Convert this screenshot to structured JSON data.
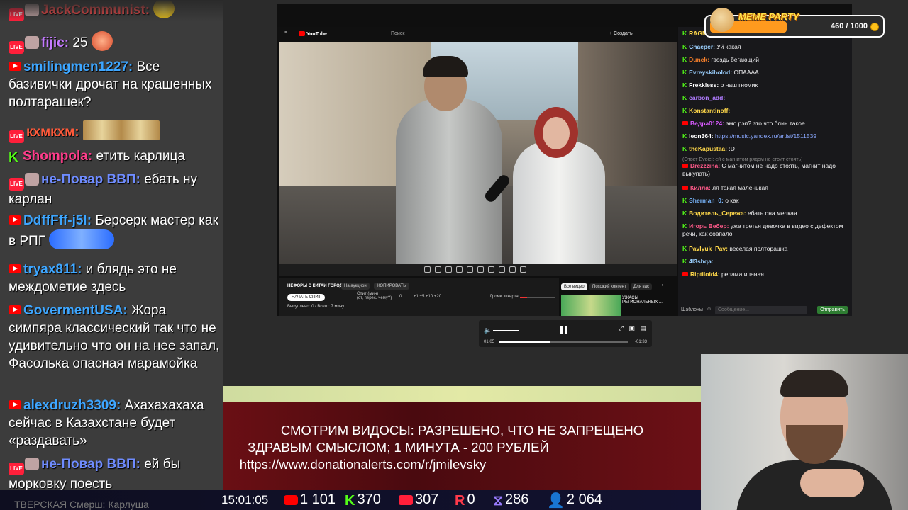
{
  "left_chat": [
    {
      "badge": "live",
      "nick": "JackCommunist:",
      "color": "#ff4a4a",
      "text": "",
      "top": 0
    },
    {
      "badge": "live",
      "nick": "fijic:",
      "color": "#c47aff",
      "text": "25"
    },
    {
      "badge": "yt",
      "nick": "smilingmen1227:",
      "color": "#3ea6ff",
      "text": "Все базивички дрочат на крашенных полтарашек?"
    },
    {
      "badge": "live",
      "nick": "кхмкхм:",
      "color": "#ff5a3a",
      "text": ""
    },
    {
      "badge": "kick",
      "nick": "Shompola:",
      "color": "#ff3d8b",
      "text": "етить карлица"
    },
    {
      "badge": "live",
      "nick": "не-Повар ВВП:",
      "color": "#6f8cff",
      "text": "ебать ну карлан"
    },
    {
      "badge": "yt",
      "nick": "DdffFff-j5l:",
      "color": "#3ea6ff",
      "text": "Берсерк мастер как в РПГ"
    },
    {
      "badge": "yt",
      "nick": "tryax811:",
      "color": "#3ea6ff",
      "text": "и блядь это не междометие здесь"
    },
    {
      "badge": "yt",
      "nick": "GovermentUSA:",
      "color": "#3ea6ff",
      "text": "Жора симпяра классический так что не удивительно что он на нее запал, Фасолька опасная марамойка"
    },
    {
      "badge": "yt",
      "nick": "alexdruzh3309:",
      "color": "#3ea6ff",
      "text": "Ахахахахаха сейчас в Казахстане будет «раздавать»"
    },
    {
      "badge": "live",
      "nick": "не-Повар ВВП:",
      "color": "#6f8cff",
      "text": "ей бы морковку поесть"
    }
  ],
  "browser": {
    "yt_logo": "YouTube",
    "search_placeholder": "Поиск",
    "create_label": "+ Создать",
    "donate_title": "НЕФОРЫ С КИТАЙ ГОРОДА",
    "auction_label": "На аукцион",
    "copy_label": "КОПИРОВАТЬ",
    "start_label": "НАЧАТЬ СПИТ",
    "spent_label": "Выкуплено: 0 / Всего: 7 минут",
    "spit_label": "Спит (мин)",
    "spit_sub": "(от, перес. чему?)",
    "spit_value": "0",
    "steps": "+1  +5  +10  +20",
    "volume_label": "Громк. шкерта",
    "reco_tabs": [
      "Все видео",
      "Похожий контент",
      "Для вас"
    ],
    "reco_title": "УЖАСЫ РЕГИОНАЛЬНЫХ ..."
  },
  "video_controls": {
    "current": "01:05",
    "remaining": "-01:33",
    "progress": 0.4
  },
  "right_chat": [
    {
      "src": "kick",
      "nick": "RAGNAROCK:",
      "color": "#ffd84a",
      "text": "ебать шкет"
    },
    {
      "src": "kick",
      "nick": "Chaeper:",
      "color": "#9bd0ff",
      "text": "Уй какая"
    },
    {
      "src": "kick",
      "nick": "Dunck:",
      "color": "#f27d2a",
      "text": "гвоздь бегающий"
    },
    {
      "src": "kick",
      "nick": "Evreyskiholod:",
      "color": "#9bd0ff",
      "text": "ОПАААА"
    },
    {
      "src": "kick",
      "nick": "Frekkless:",
      "color": "#ffffff",
      "text": "о наш гномик"
    },
    {
      "src": "kick",
      "nick": "carbon_add:",
      "color": "#b07cff",
      "text": ""
    },
    {
      "src": "kick",
      "nick": "Konstantinoff:",
      "color": "#ffd84a",
      "text": ""
    },
    {
      "src": "yt",
      "nick": "Ведра0124:",
      "color": "#d85aff",
      "text": "эмо рэп? это что блин такое"
    },
    {
      "src": "kick",
      "nick": "leon364:",
      "color": "#ffffff",
      "text": "",
      "link": "https://music.yandex.ru/artist/1511539"
    },
    {
      "src": "kick",
      "nick": "theKapustaa:",
      "color": "#ffd84a",
      "text": ":D"
    },
    {
      "src": "sub",
      "nick": "",
      "color": "#888",
      "text": "(Ответ Evoiel: ей с магнитом рядом не стоит стоять)"
    },
    {
      "src": "yt",
      "nick": "Drezzzina:",
      "color": "#ff5a8a",
      "text": "С магнитом не надо стоять, магнит надо выкупать)"
    },
    {
      "src": "yt",
      "nick": "Килла:",
      "color": "#ff5a8a",
      "text": "ля такая маленькая"
    },
    {
      "src": "kick",
      "nick": "Sherman_0:",
      "color": "#7ab8ff",
      "text": "о как"
    },
    {
      "src": "kick",
      "nick": "Водитель_Сережа:",
      "color": "#ffd84a",
      "text": "ебать она мелкая"
    },
    {
      "src": "kick",
      "nick": "Игорь Вебер:",
      "color": "#ff5a8a",
      "text": "уже третья девочка в видео с дефектом речи, как совпало"
    },
    {
      "src": "kick",
      "nick": "Pavlyuk_Pav:",
      "color": "#ffd84a",
      "text": "веселая полторашка"
    },
    {
      "src": "kick",
      "nick": "4l3shqa:",
      "color": "#9bd0ff",
      "text": ""
    },
    {
      "src": "yt",
      "nick": "Riptiloid4:",
      "color": "#ffd84a",
      "text": "релама ипаная"
    }
  ],
  "chat_input": {
    "templates": "Шаблоны",
    "placeholder": "Сообщение...",
    "send": "Отправить"
  },
  "meme_party": {
    "title": "MEME PARTY",
    "count": "460 / 1000",
    "progress": 0.46
  },
  "banner": {
    "line1": "СМОТРИМ ВИДОСЫ: РАЗРЕШЕНО, ЧТО НЕ ЗАПРЕЩЕНО",
    "line2": "ЗДРАВЫМ СМЫСЛОМ; 1 МИНУТА - 200 РУБЛЕЙ",
    "line3": "https://www.donationalerts.com/r/jmilevsky"
  },
  "stats": {
    "ghost_text": "ТВЕРСКАЯ Смерш: Карлуша",
    "clock": "15:01:05",
    "youtube": "1 101",
    "kick": "370",
    "live": "307",
    "r": "0",
    "x": "286",
    "viewers": "2 064"
  }
}
